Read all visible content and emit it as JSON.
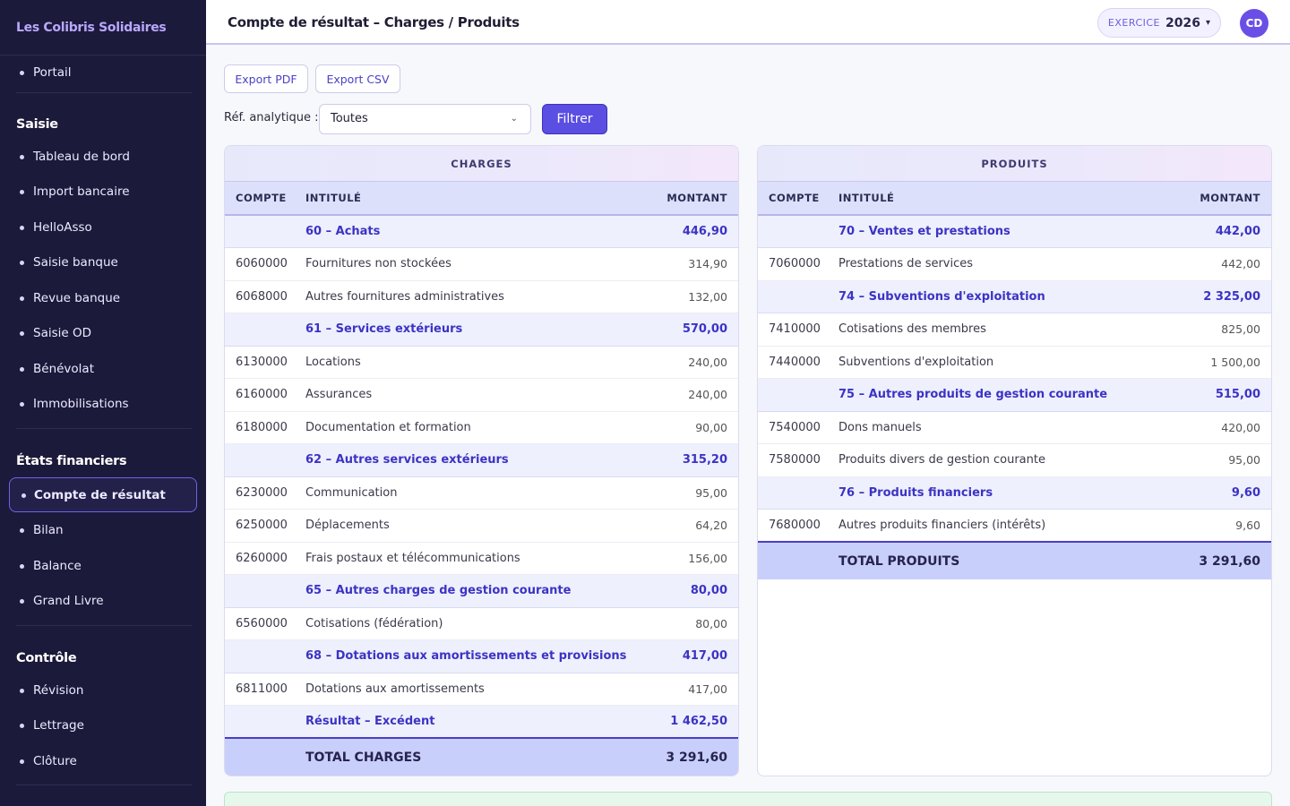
{
  "brand": "Les Colibris Solidaires",
  "sidebar": {
    "portal": "Portail",
    "saisie_title": "Saisie",
    "saisie_items": [
      "Tableau de bord",
      "Import bancaire",
      "HelloAsso",
      "Saisie banque",
      "Revue banque",
      "Saisie OD",
      "Bénévolat",
      "Immobilisations"
    ],
    "etats_title": "États financiers",
    "etats_active": "Compte de résultat",
    "etats_items": [
      "Bilan",
      "Balance",
      "Grand Livre"
    ],
    "controle_title": "Contrôle",
    "controle_items": [
      "Révision",
      "Lettrage",
      "Clôture"
    ]
  },
  "header": {
    "title": "Compte de résultat – Charges / Produits",
    "exercice_label": "EXERCICE",
    "exercice_year": "2026",
    "avatar": "CD"
  },
  "toolbar": {
    "export_pdf": "Export PDF",
    "export_csv": "Export CSV",
    "filter_label": "Réf. analytique :",
    "filter_value": "Toutes",
    "filter_button": "Filtrer"
  },
  "columns": {
    "compte": "COMPTE",
    "intitule": "INTITULÉ",
    "montant": "MONTANT"
  },
  "charges": {
    "title": "CHARGES",
    "rows": [
      {
        "type": "group",
        "compte": "",
        "intitule": "60 – Achats",
        "montant": "446,90"
      },
      {
        "type": "row",
        "compte": "6060000",
        "intitule": "Fournitures non stockées",
        "montant": "314,90"
      },
      {
        "type": "row",
        "compte": "6068000",
        "intitule": "Autres fournitures administratives",
        "montant": "132,00"
      },
      {
        "type": "group",
        "compte": "",
        "intitule": "61 – Services extérieurs",
        "montant": "570,00"
      },
      {
        "type": "row",
        "compte": "6130000",
        "intitule": "Locations",
        "montant": "240,00"
      },
      {
        "type": "row",
        "compte": "6160000",
        "intitule": "Assurances",
        "montant": "240,00"
      },
      {
        "type": "row",
        "compte": "6180000",
        "intitule": "Documentation et formation",
        "montant": "90,00"
      },
      {
        "type": "group",
        "compte": "",
        "intitule": "62 – Autres services extérieurs",
        "montant": "315,20"
      },
      {
        "type": "row",
        "compte": "6230000",
        "intitule": "Communication",
        "montant": "95,00"
      },
      {
        "type": "row",
        "compte": "6250000",
        "intitule": "Déplacements",
        "montant": "64,20"
      },
      {
        "type": "row",
        "compte": "6260000",
        "intitule": "Frais postaux et télécommunications",
        "montant": "156,00"
      },
      {
        "type": "group",
        "compte": "",
        "intitule": "65 – Autres charges de gestion courante",
        "montant": "80,00"
      },
      {
        "type": "row",
        "compte": "6560000",
        "intitule": "Cotisations (fédération)",
        "montant": "80,00"
      },
      {
        "type": "group",
        "compte": "",
        "intitule": "68 – Dotations aux amortissements et provisions",
        "montant": "417,00"
      },
      {
        "type": "row",
        "compte": "6811000",
        "intitule": "Dotations aux amortissements",
        "montant": "417,00"
      },
      {
        "type": "group",
        "compte": "",
        "intitule": "Résultat – Excédent",
        "montant": "1 462,50"
      }
    ],
    "total_label": "TOTAL CHARGES",
    "total_value": "3 291,60"
  },
  "produits": {
    "title": "PRODUITS",
    "rows": [
      {
        "type": "group",
        "compte": "",
        "intitule": "70 – Ventes et prestations",
        "montant": "442,00"
      },
      {
        "type": "row",
        "compte": "7060000",
        "intitule": "Prestations de services",
        "montant": "442,00"
      },
      {
        "type": "group",
        "compte": "",
        "intitule": "74 – Subventions d'exploitation",
        "montant": "2 325,00"
      },
      {
        "type": "row",
        "compte": "7410000",
        "intitule": "Cotisations des membres",
        "montant": "825,00"
      },
      {
        "type": "row",
        "compte": "7440000",
        "intitule": "Subventions d'exploitation",
        "montant": "1 500,00"
      },
      {
        "type": "group",
        "compte": "",
        "intitule": "75 – Autres produits de gestion courante",
        "montant": "515,00"
      },
      {
        "type": "row",
        "compte": "7540000",
        "intitule": "Dons manuels",
        "montant": "420,00"
      },
      {
        "type": "row",
        "compte": "7580000",
        "intitule": "Produits divers de gestion courante",
        "montant": "95,00"
      },
      {
        "type": "group",
        "compte": "",
        "intitule": "76 – Produits financiers",
        "montant": "9,60"
      },
      {
        "type": "row",
        "compte": "7680000",
        "intitule": "Autres produits financiers (intérêts)",
        "montant": "9,60"
      }
    ],
    "total_label": "TOTAL PRODUITS",
    "total_value": "3 291,60"
  }
}
